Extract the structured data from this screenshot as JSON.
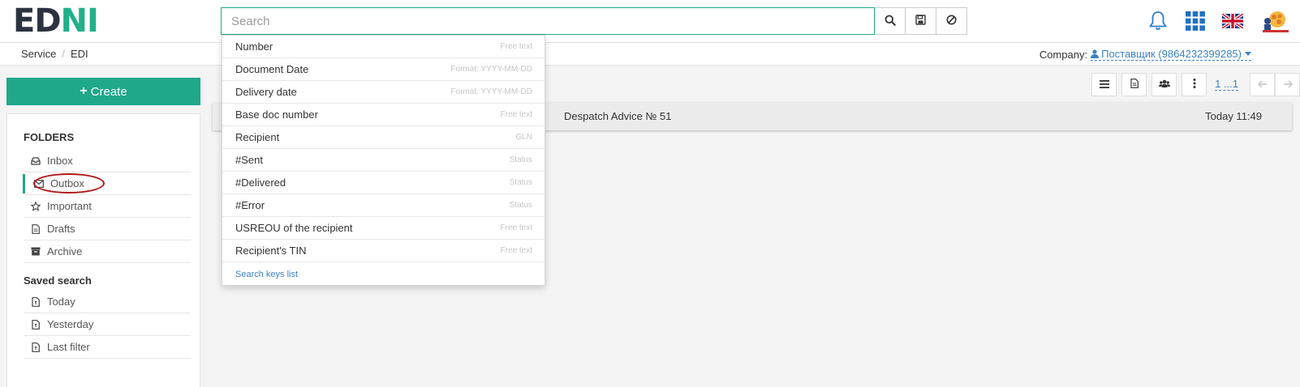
{
  "brand": {
    "part1": "ED",
    "part2": "NI"
  },
  "search": {
    "placeholder": "Search",
    "buttons": [
      "search-icon",
      "save-icon",
      "clear-icon"
    ]
  },
  "search_keys": [
    {
      "key": "Number",
      "hint": "Free text"
    },
    {
      "key": "Document Date",
      "hint": "Format: YYYY-MM-DD"
    },
    {
      "key": "Delivery date",
      "hint": "Format: YYYY-MM-DD"
    },
    {
      "key": "Base doc number",
      "hint": "Free text"
    },
    {
      "key": "Recipient",
      "hint": "GLN"
    },
    {
      "key": "#Sent",
      "hint": "Status"
    },
    {
      "key": "#Delivered",
      "hint": "Status"
    },
    {
      "key": "#Error",
      "hint": "Status"
    },
    {
      "key": "USREOU of the recipient",
      "hint": "Free text"
    },
    {
      "key": "Recipient's TIN",
      "hint": "Free text"
    }
  ],
  "search_footer": "Search keys list",
  "top_icons": [
    "bell-icon",
    "apps-grid-icon",
    "uk-flag-icon",
    "user-avatar-icon"
  ],
  "breadcrumb": [
    "Service",
    "EDI"
  ],
  "company": {
    "label": "Company:",
    "value": "Поставщик (9864232399285)"
  },
  "create_button": "Create",
  "folders": {
    "title": "FOLDERS",
    "items": [
      "Inbox",
      "Outbox",
      "Important",
      "Drafts",
      "Archive"
    ],
    "active": "Outbox"
  },
  "saved_search": {
    "title": "Saved search",
    "items": [
      "Today",
      "Yesterday",
      "Last filter"
    ]
  },
  "pagination": "1 ...1",
  "message": {
    "subject": "Despatch Advice № 51",
    "time": "Today 11:49"
  },
  "colors": {
    "accent": "#1fa88a",
    "link": "#3a82c4",
    "highlight_ring": "#b01818"
  }
}
